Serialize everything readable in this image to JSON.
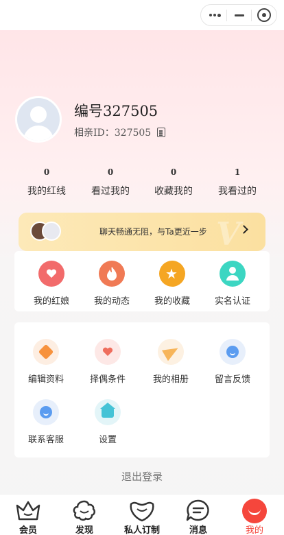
{
  "profile": {
    "name": "编号327505",
    "id_label": "相亲ID：327505"
  },
  "stats": [
    {
      "count": "0",
      "label": "我的红线"
    },
    {
      "count": "0",
      "label": "看过我的"
    },
    {
      "count": "0",
      "label": "收藏我的"
    },
    {
      "count": "1",
      "label": "我看过的"
    }
  ],
  "vip_banner": {
    "text": "聊天畅通无阻，与Ta更近一步",
    "watermark": "V"
  },
  "quick_actions": [
    {
      "label": "我的红娘",
      "icon": "heart-icon"
    },
    {
      "label": "我的动态",
      "icon": "flame-icon"
    },
    {
      "label": "我的收藏",
      "icon": "star-icon"
    },
    {
      "label": "实名认证",
      "icon": "person-verify-icon"
    }
  ],
  "services": [
    {
      "label": "编辑资料",
      "icon": "edit-profile-icon"
    },
    {
      "label": "择偶条件",
      "icon": "heart-pen-icon"
    },
    {
      "label": "我的相册",
      "icon": "paper-plane-icon"
    },
    {
      "label": "留言反馈",
      "icon": "chat-bubble-icon"
    },
    {
      "label": "联系客服",
      "icon": "service-bubble-icon"
    },
    {
      "label": "设置",
      "icon": "house-settings-icon"
    }
  ],
  "logout_label": "退出登录",
  "tabbar": {
    "items": [
      {
        "label": "会员",
        "icon": "crown-icon"
      },
      {
        "label": "发现",
        "icon": "flower-icon"
      },
      {
        "label": "私人订制",
        "icon": "smile-heart-icon"
      },
      {
        "label": "消息",
        "icon": "message-icon"
      },
      {
        "label": "我的",
        "icon": "me-icon"
      }
    ],
    "active_index": 4,
    "active_color": "#f5463c"
  },
  "colors": {
    "accent": "#f5463c",
    "banner": "#fbe0a0"
  }
}
